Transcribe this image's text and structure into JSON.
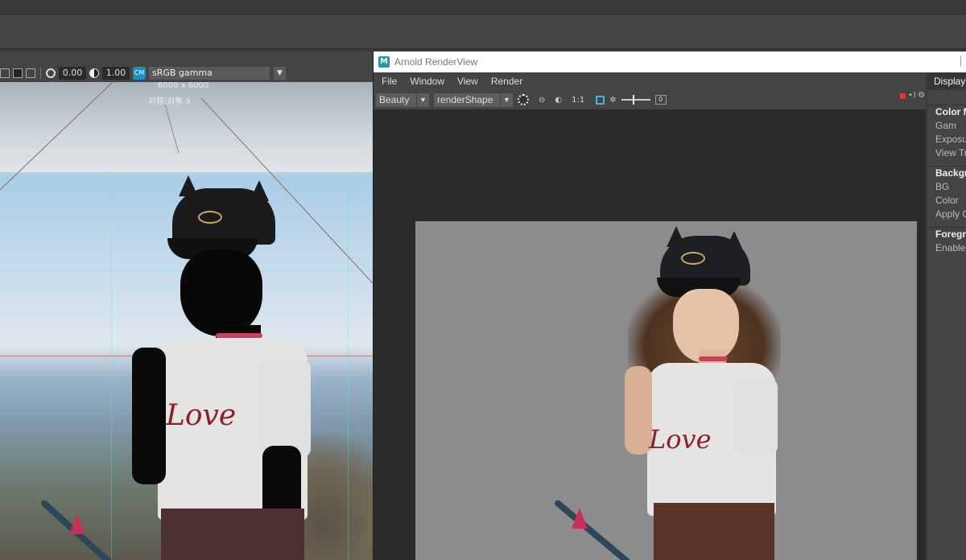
{
  "viewport": {
    "exposure_value": "0.00",
    "gamma_value": "1.00",
    "color_management_icon": "color-management-icon",
    "color_space": "sRGB gamma",
    "resolution_label": "6000 x 6000",
    "object_label": "对称:对象 X"
  },
  "render_view": {
    "title": "Arnold RenderView",
    "logo_letter": "M",
    "menu": [
      "File",
      "Window",
      "View",
      "Render"
    ],
    "aov": "Beauty",
    "camera": "renderShape",
    "ratio_label": "1:1",
    "slider_value": "0",
    "icons": [
      "sun-icon",
      "region-icon",
      "refresh-icon",
      "frame-icon",
      "exposure-icon",
      "stop-icon",
      "sound-icon",
      "gear-icon"
    ]
  },
  "display_panel": {
    "tab_label": "Display",
    "sections": [
      {
        "header": "Color M",
        "rows": [
          "Gam",
          "Exposu",
          "View Tra"
        ]
      },
      {
        "header": "Backgro",
        "rows": [
          "BG",
          "Color",
          "Apply C"
        ]
      },
      {
        "header": "Foregro",
        "rows": [
          "Enable"
        ]
      }
    ]
  },
  "scene": {
    "shirt_text": "Love"
  },
  "colors": {
    "title_bar": "#ffffff",
    "panel_bg": "#444444",
    "canvas_bg": "#2b2b2b",
    "render_bg": "#8c8c8c",
    "accent_blue": "#1d8fbf",
    "stop_red": "#d23b3b"
  }
}
